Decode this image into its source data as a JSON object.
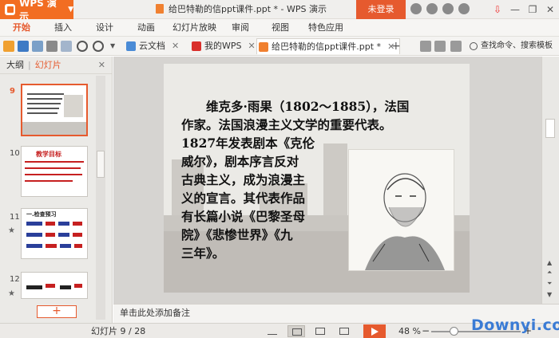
{
  "titlebar": {
    "app_name": "WPS 演示",
    "window_title": "给巴特勒的信ppt课件.ppt * - WPS 演示",
    "login_label": "未登录"
  },
  "menu": {
    "items": [
      "开始",
      "插入",
      "设计",
      "动画",
      "幻灯片放映",
      "审阅",
      "视图",
      "特色应用"
    ],
    "active_index": 0
  },
  "toolbar": {
    "tabs": [
      {
        "label": "云文档",
        "icon": "cloud-doc-icon"
      },
      {
        "label": "我的WPS",
        "icon": "wps-icon"
      },
      {
        "label": "给巴特勒的信ppt课件.ppt *",
        "icon": "ppt-file-icon"
      }
    ],
    "search_label": "查找命令、搜索模板"
  },
  "left_panel": {
    "tab_outline": "大纲",
    "tab_slides": "幻灯片",
    "slides": [
      {
        "number": "9",
        "selected": true
      },
      {
        "number": "10",
        "selected": false,
        "title": "教学目标"
      },
      {
        "number": "11",
        "selected": false,
        "title": "一.检查预习"
      },
      {
        "number": "12",
        "selected": false
      }
    ],
    "add_label": "+"
  },
  "slide": {
    "lines": [
      "　　维克多·雨果（1802～1885），法国",
      "作家。法国浪漫主义文学的重要代表。",
      "1827年发表剧本《克伦",
      "威尔》，剧本序言反对",
      "古典主义，成为浪漫主",
      "义的宣言。其代表作品",
      "有长篇小说《巴黎圣母",
      "院》《悲惨世界》《九",
      "三年》。"
    ]
  },
  "notes": {
    "placeholder": "单击此处添加备注"
  },
  "status": {
    "slide_info": "幻灯片 9 / 28",
    "zoom": "48 %"
  },
  "watermark": "Downyi.com",
  "colors": {
    "accent": "#e65a2e",
    "app_orange": "#f26d22"
  }
}
